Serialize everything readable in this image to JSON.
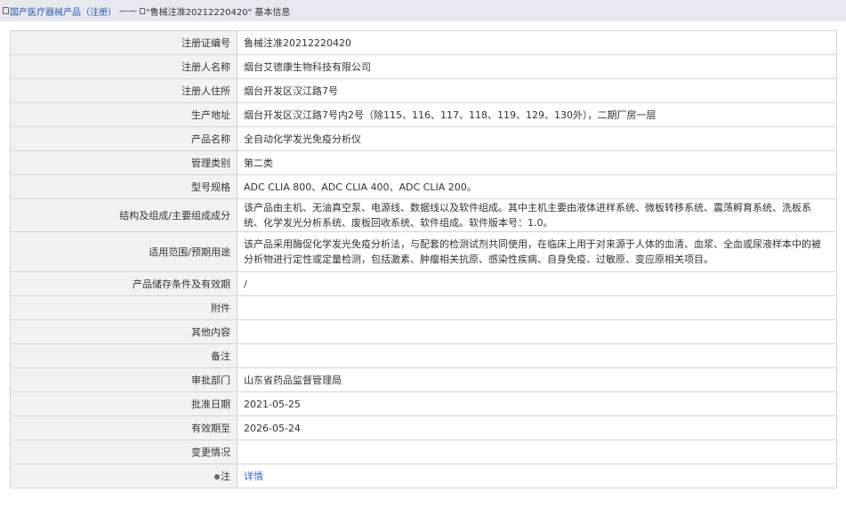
{
  "breadcrumb": {
    "category": "国产医疗器械产品（注册）",
    "separator": "——",
    "current": "\"鲁械注准20212220420\" 基本信息"
  },
  "rows": [
    {
      "label": "注册证编号",
      "value": "鲁械注准20212220420"
    },
    {
      "label": "注册人名称",
      "value": "烟台艾德康生物科技有限公司"
    },
    {
      "label": "注册人住所",
      "value": "烟台开发区汉江路7号"
    },
    {
      "label": "生产地址",
      "value": "烟台开发区汉江路7号内2号（除115、116、117、118、119、129、130外），二期厂房一层"
    },
    {
      "label": "产品名称",
      "value": "全自动化学发光免疫分析仪"
    },
    {
      "label": "管理类别",
      "value": "第二类"
    },
    {
      "label": "型号规格",
      "value": "ADC CLIA 800、ADC CLIA 400、ADC CLIA 200。"
    },
    {
      "label": "结构及组成/主要组成成分",
      "value": "该产品由主机、无油真空泵、电源线、数据线以及软件组成。其中主机主要由液体进样系统、微板转移系统、震荡孵育系统、洗板系统、化学发光分析系统、废板回收系统、软件组成。软件版本号：1.0。"
    },
    {
      "label": "适用范围/预期用途",
      "value": "该产品采用酶促化学发光免疫分析法，与配套的检测试剂共同使用，在临床上用于对来源于人体的血清、血浆、全血或尿液样本中的被分析物进行定性或定量检测，包括激素、肿瘤相关抗原、感染性疾病、自身免疫、过敏原、变应原相关项目。"
    },
    {
      "label": "产品储存条件及有效期",
      "value": "/"
    },
    {
      "label": "附件",
      "value": ""
    },
    {
      "label": "其他内容",
      "value": ""
    },
    {
      "label": "备注",
      "value": ""
    },
    {
      "label": "审批部门",
      "value": "山东省药品监督管理局"
    },
    {
      "label": "批准日期",
      "value": "2021-05-25"
    },
    {
      "label": "有效期至",
      "value": "2026-05-24"
    },
    {
      "label": "变更情况",
      "value": ""
    }
  ],
  "note": {
    "label": "注",
    "link_text": "详情",
    "icon": "note-bullet-icon"
  }
}
